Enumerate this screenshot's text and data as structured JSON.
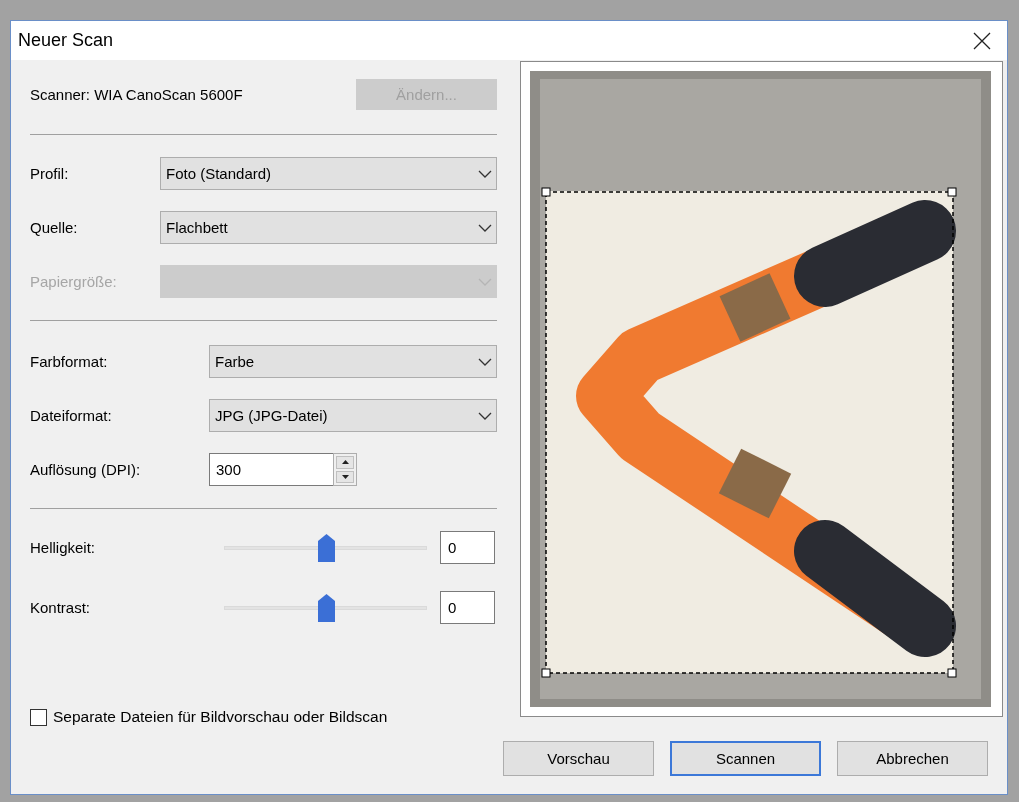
{
  "window": {
    "title": "Neuer Scan"
  },
  "scanner": {
    "label": "Scanner: WIA CanoScan 5600F",
    "change_button": {
      "label": "Ändern...",
      "disabled": true
    }
  },
  "groups": [
    {
      "fields": [
        {
          "kind": "dropdown",
          "label": "Profil:",
          "value": "Foto (Standard)",
          "disabled": false
        },
        {
          "kind": "dropdown",
          "label": "Quelle:",
          "value": "Flachbett",
          "disabled": false
        },
        {
          "kind": "dropdown",
          "label": "Papiergröße:",
          "disabled": true
        }
      ]
    },
    {
      "fields": [
        {
          "kind": "dropdown",
          "label": "Farbformat:",
          "value": "Farbe",
          "disabled": false
        },
        {
          "kind": "dropdown",
          "label": "Dateiformat:",
          "value": "JPG (JPG-Datei)",
          "disabled": false
        },
        {
          "kind": "spinner",
          "label": "Auflösung (DPI):",
          "value": "300",
          "disabled": false
        }
      ]
    },
    {
      "fields": [
        {
          "kind": "slider",
          "label": "Helligkeit:",
          "level": 0.5,
          "value": "0",
          "disabled": false
        },
        {
          "kind": "slider",
          "label": "Kontrast:",
          "level": 0.5,
          "value": "0",
          "disabled": false
        }
      ]
    }
  ],
  "checkbox": {
    "label": "Separate Dateien für Bildvorschau oder Bildscan",
    "checked": false
  },
  "buttons": [
    {
      "label": "Vorschau",
      "default": false
    },
    {
      "label": "Scannen",
      "default": true
    },
    {
      "label": "Abbrechen",
      "default": false
    }
  ]
}
